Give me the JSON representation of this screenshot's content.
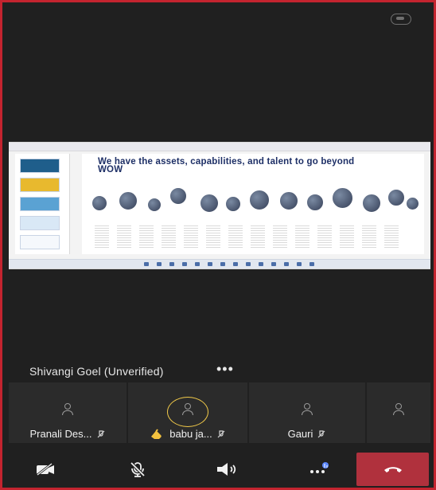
{
  "share": {
    "slide_title": "We have the assets, capabilities, and talent to go beyond WOW"
  },
  "presenter": {
    "name": "Shivangi Goel (Unverified)",
    "more": "•••"
  },
  "participants": [
    {
      "name": "Pranali Des...",
      "muted": true
    },
    {
      "name": "babu ja...",
      "muted": true,
      "hand_raised": true,
      "speaking": true
    },
    {
      "name": "Gauri",
      "muted": true
    },
    {
      "name": "",
      "muted": false
    }
  ],
  "colors": {
    "frame": "#c4242f",
    "end_call": "#b0313d",
    "speaker_ring": "#f2ca49",
    "hand": "#f3c23f",
    "raise_hand_dot": "#5b87ff"
  },
  "icons": {
    "camera": "camera-off-icon",
    "mic": "mic-off-icon",
    "speaker": "speaker-icon",
    "more": "more-actions-icon",
    "end_call": "phone-end-icon"
  }
}
